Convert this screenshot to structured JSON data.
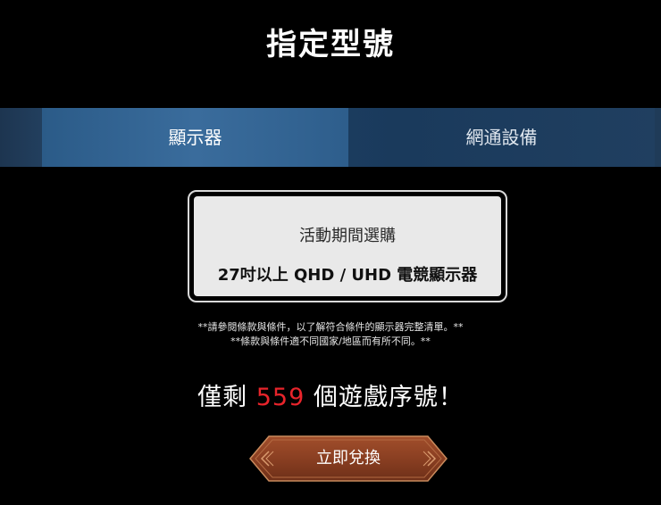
{
  "title": "指定型號",
  "tabs": [
    {
      "label": "顯示器",
      "active": true
    },
    {
      "label": "網通設備",
      "active": false
    }
  ],
  "promo": {
    "line1": "活動期間選購",
    "line2": "27吋以上 QHD / UHD 電競顯示器"
  },
  "notes": [
    "**請參閱條款與條件，以了解符合條件的顯示器完整清單。**",
    "**條款與條件適不同國家/地區而有所不同。**"
  ],
  "remaining": {
    "prefix": "僅剩",
    "count": "559",
    "suffix": "個遊戲序號！"
  },
  "redeem_button": {
    "label": "立即兌換"
  },
  "colors": {
    "background": "#000000",
    "tab_active": "#3a6c9c",
    "tab_bar": "#1d3f63",
    "count_highlight": "#e8242b",
    "button": "#8a3f22"
  }
}
